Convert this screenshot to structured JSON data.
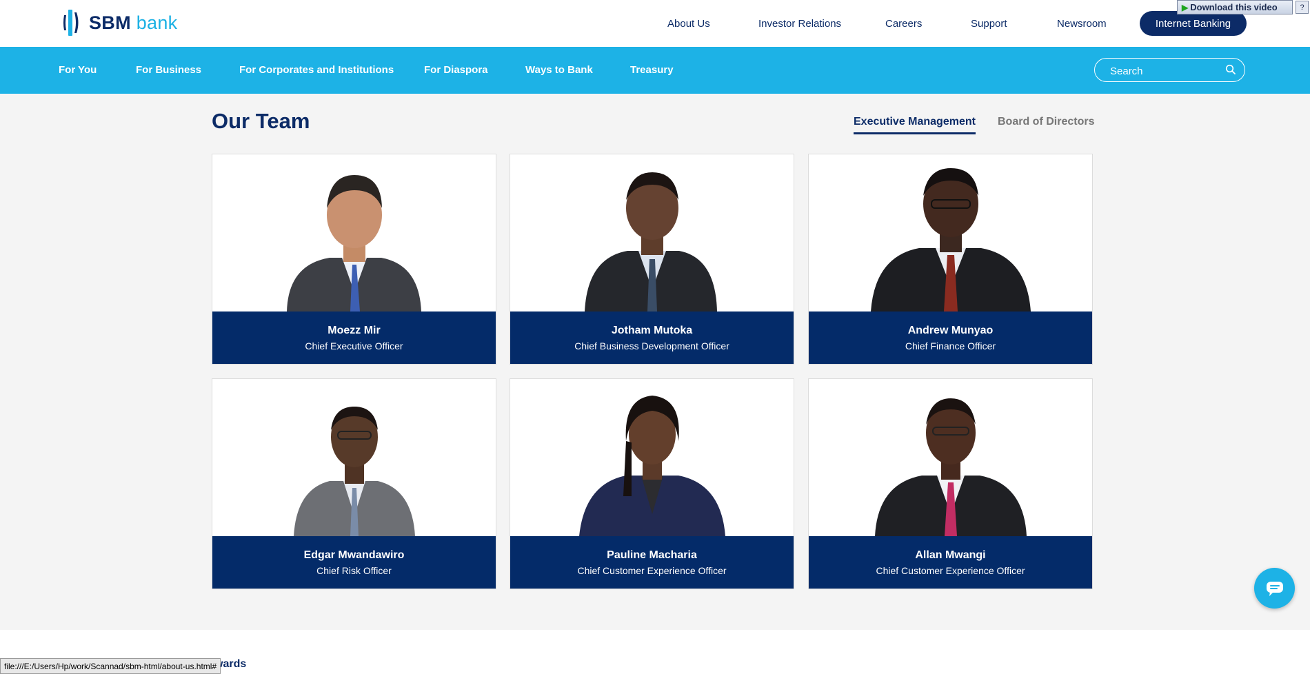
{
  "brand": {
    "name_part1": "SBM",
    "name_part2": "bank",
    "primary": "#0c2b67",
    "accent": "#1db2e6"
  },
  "top_nav": {
    "items": [
      "About Us",
      "Investor Relations",
      "Careers",
      "Support",
      "Newsroom"
    ],
    "cta": "Internet Banking"
  },
  "browser_overlay": {
    "download_video": "Download this video",
    "help": "?"
  },
  "main_nav": {
    "items": [
      "For You",
      "For Business",
      "For Corporates and Institutions",
      "For Diaspora",
      "Ways to Bank",
      "Treasury"
    ],
    "search_placeholder": "Search"
  },
  "team": {
    "title": "Our Team",
    "tabs": [
      "Executive Management",
      "Board of Directors"
    ],
    "active_tab": "Executive Management",
    "members": [
      {
        "name": "Moezz Mir",
        "role": "Chief Executive Officer"
      },
      {
        "name": "Jotham Mutoka",
        "role": "Chief Business Development Officer"
      },
      {
        "name": "Andrew Munyao",
        "role": "Chief Finance Officer"
      },
      {
        "name": "Edgar Mwandawiro",
        "role": "Chief Risk Officer"
      },
      {
        "name": "Pauline Macharia",
        "role": "Chief Customer Experience Officer"
      },
      {
        "name": "Allan Mwangi",
        "role": "Chief Customer Experience Officer"
      }
    ]
  },
  "next_section_partial": "wards",
  "status_bar_url": "file:///E:/Users/Hp/work/Scannad/sbm-html/about-us.html#",
  "icons": [
    "sbm-logo-icon",
    "search-icon",
    "chat-icon",
    "play-icon"
  ]
}
